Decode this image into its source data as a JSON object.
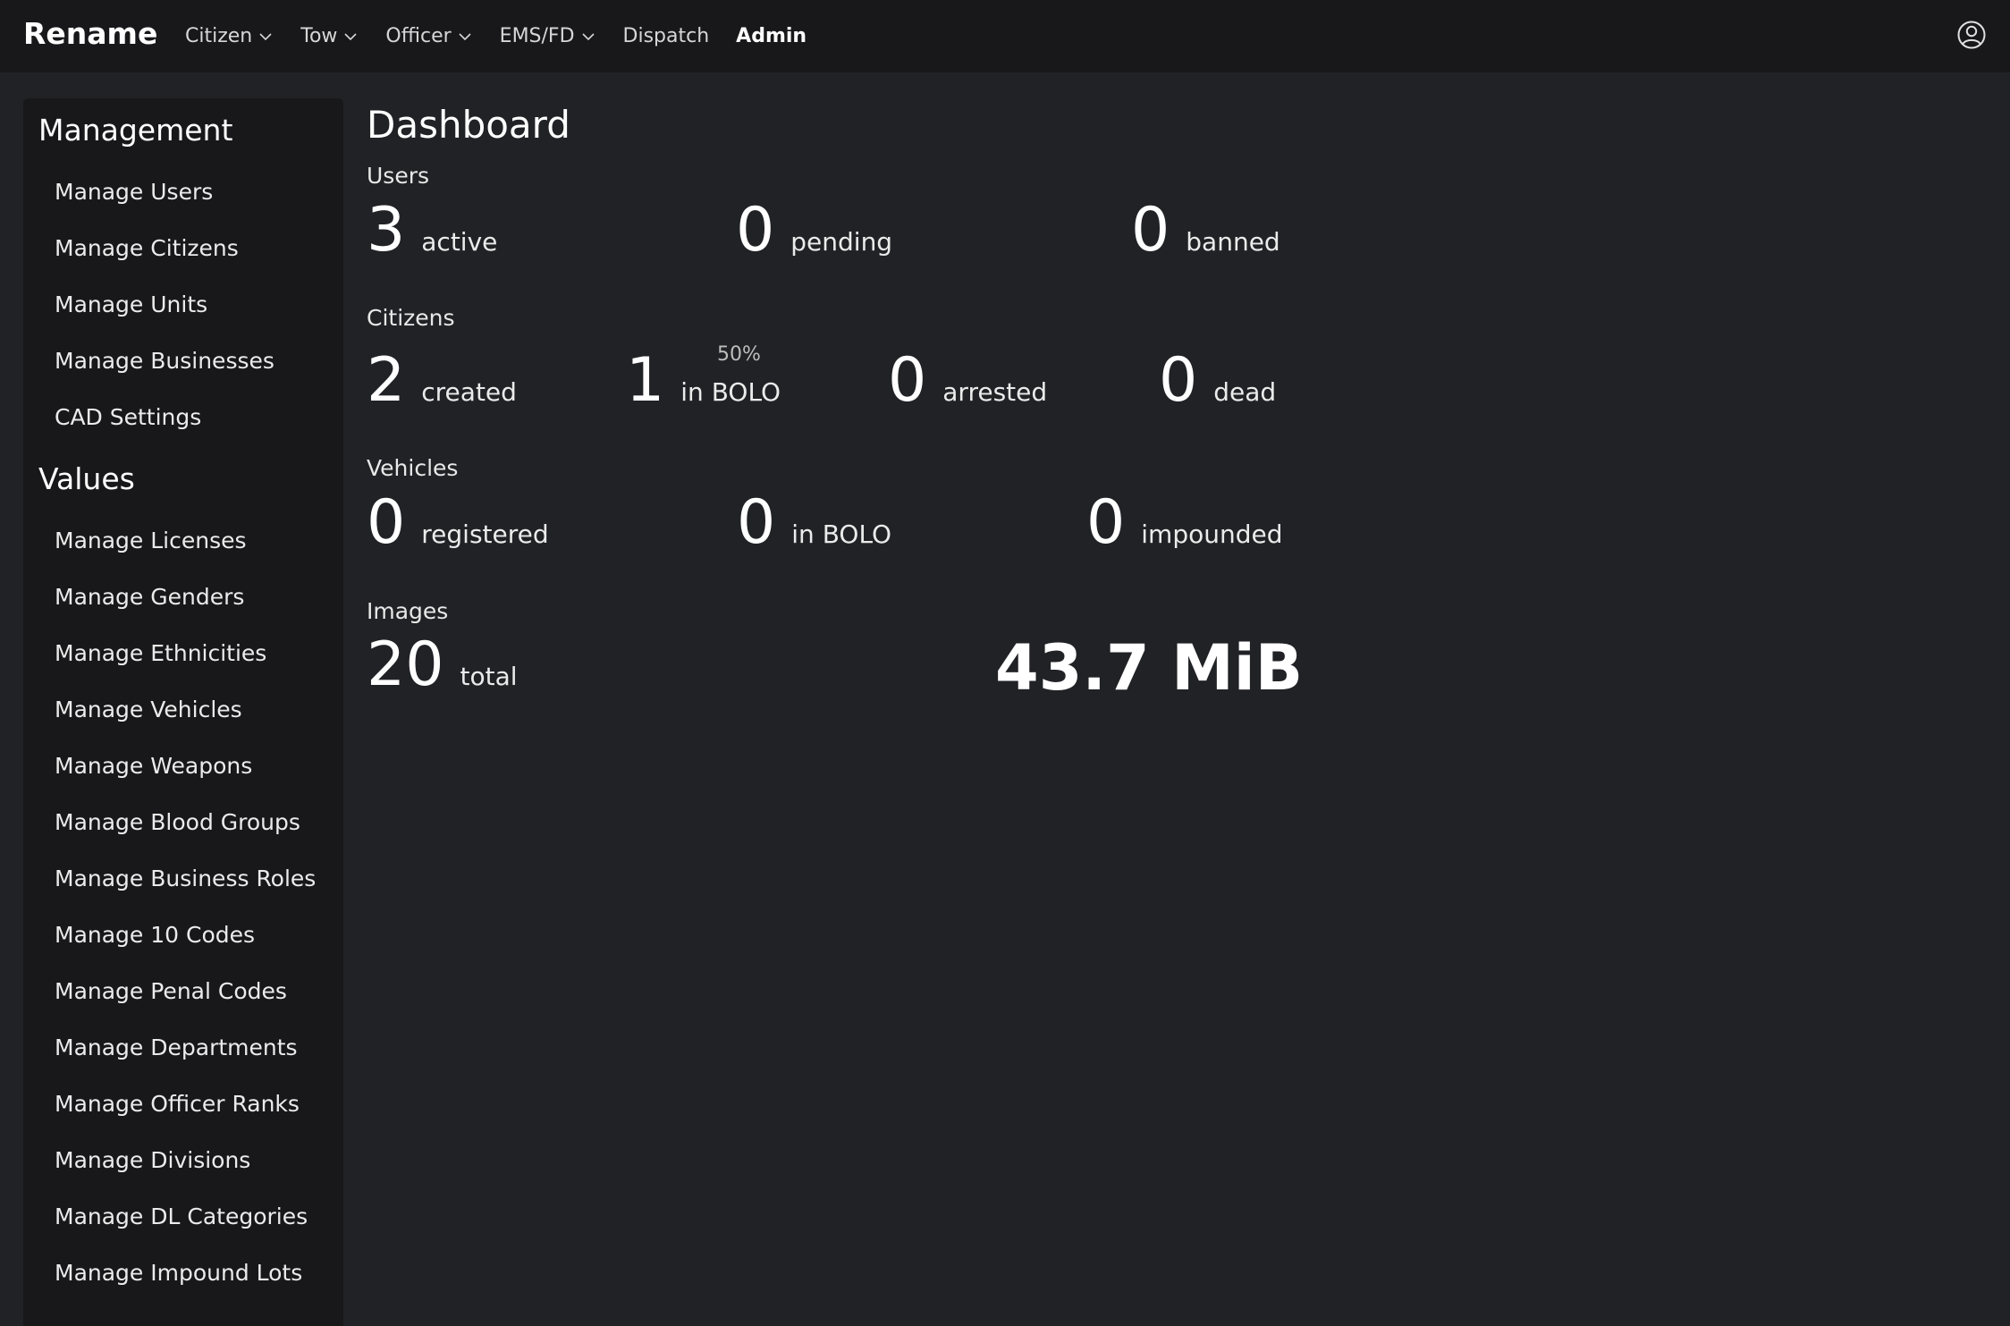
{
  "app": {
    "brand": "Rename"
  },
  "nav": {
    "items": [
      {
        "label": "Citizen",
        "dropdown": true
      },
      {
        "label": "Tow",
        "dropdown": true
      },
      {
        "label": "Officer",
        "dropdown": true
      },
      {
        "label": "EMS/FD",
        "dropdown": true
      },
      {
        "label": "Dispatch",
        "dropdown": false
      },
      {
        "label": "Admin",
        "dropdown": false,
        "active": true
      }
    ],
    "account_icon": "user-circle-icon"
  },
  "sidebar": {
    "management_heading": "Management",
    "management_items": [
      "Manage Users",
      "Manage Citizens",
      "Manage Units",
      "Manage Businesses",
      "CAD Settings"
    ],
    "values_heading": "Values",
    "values_items": [
      "Manage Licenses",
      "Manage Genders",
      "Manage Ethnicities",
      "Manage Vehicles",
      "Manage Weapons",
      "Manage Blood Groups",
      "Manage Business Roles",
      "Manage 10 Codes",
      "Manage Penal Codes",
      "Manage Departments",
      "Manage Officer Ranks",
      "Manage Divisions",
      "Manage DL Categories",
      "Manage Impound Lots"
    ]
  },
  "dashboard": {
    "title": "Dashboard",
    "users": {
      "label": "Users",
      "active": {
        "value": "3",
        "label": "active"
      },
      "pending": {
        "value": "0",
        "label": "pending"
      },
      "banned": {
        "value": "0",
        "label": "banned"
      }
    },
    "citizens": {
      "label": "Citizens",
      "created": {
        "value": "2",
        "label": "created"
      },
      "bolo": {
        "value": "1",
        "label": "in BOLO",
        "percent": "50%"
      },
      "arrested": {
        "value": "0",
        "label": "arrested"
      },
      "dead": {
        "value": "0",
        "label": "dead"
      }
    },
    "vehicles": {
      "label": "Vehicles",
      "registered": {
        "value": "0",
        "label": "registered"
      },
      "bolo": {
        "value": "0",
        "label": "in BOLO"
      },
      "impounded": {
        "value": "0",
        "label": "impounded"
      }
    },
    "images": {
      "label": "Images",
      "total": {
        "value": "20",
        "label": "total"
      },
      "size": "43.7 MiB"
    }
  },
  "colors": {
    "background": "#212226",
    "topbar": "#18181a",
    "sidebar": "#18181a",
    "text": "#ffffff"
  }
}
